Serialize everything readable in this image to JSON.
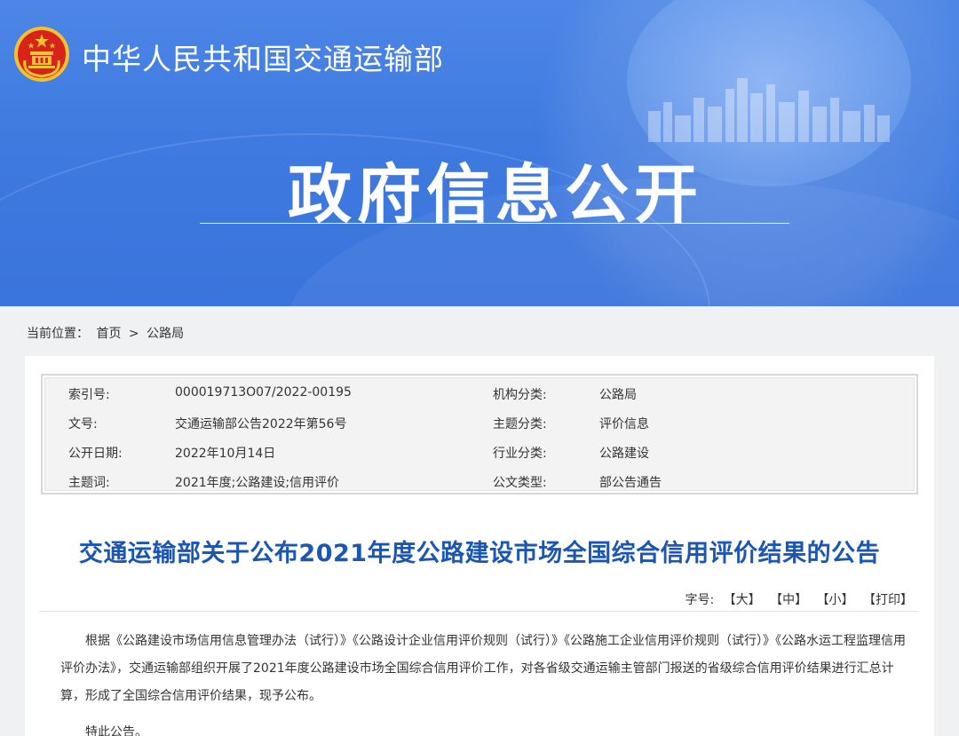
{
  "header": {
    "site_title": "中华人民共和国交通运输部",
    "banner_title": "政府信息公开"
  },
  "breadcrumb": {
    "label": "当前位置：",
    "home": "首页",
    "separator": ">",
    "current": "公路局"
  },
  "meta": {
    "rows": [
      {
        "k1": "索引号:",
        "v1": "000019713O07/2022-00195",
        "k2": "机构分类:",
        "v2": "公路局"
      },
      {
        "k1": "文号:",
        "v1": "交通运输部公告2022年第56号",
        "k2": "主题分类:",
        "v2": "评价信息"
      },
      {
        "k1": "公开日期:",
        "v1": "2022年10月14日",
        "k2": "行业分类:",
        "v2": "公路建设"
      },
      {
        "k1": "主题词:",
        "v1": "2021年度;公路建设;信用评价",
        "k2": "公文类型:",
        "v2": "部公告通告"
      }
    ]
  },
  "article": {
    "title": "交通运输部关于公布2021年度公路建设市场全国综合信用评价结果的公告",
    "font_controls": {
      "label": "字号:",
      "large": "【大】",
      "medium": "【中】",
      "small": "【小】",
      "print": "【打印】"
    },
    "paragraph1": "根据《公路建设市场信用信息管理办法（试行）》《公路设计企业信用评价规则（试行）》《公路施工企业信用评价规则（试行）》《公路水运工程监理信用评价办法》，交通运输部组织开展了2021年度公路建设市场全国综合信用评价工作，对各省级交通运输主管部门报送的省级综合信用评价结果进行汇总计算，形成了全国综合信用评价结果，现予公布。",
    "closing": "特此公告。"
  },
  "colors": {
    "banner_blue": "#3f7ae0",
    "title_blue": "#1b56b3",
    "emblem_red": "#d8231a",
    "emblem_gold": "#f2c230"
  }
}
